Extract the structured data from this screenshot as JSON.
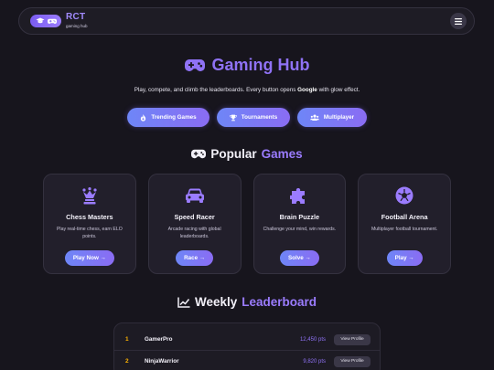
{
  "header": {
    "brand_name": "RCT",
    "brand_sub": "gaming hub",
    "logo_icons": [
      "graduation-cap-icon",
      "gamepad-icon"
    ],
    "menu_icon": "hamburger-icon"
  },
  "hero": {
    "title": "Gaming Hub",
    "subtitle_pre": "Play, compete, and climb the leaderboards. Every button opens ",
    "subtitle_bold": "Google",
    "subtitle_post": " with glow effect.",
    "buttons": [
      {
        "label": "Trending Games",
        "icon": "fire-icon"
      },
      {
        "label": "Tournaments",
        "icon": "trophy-icon"
      },
      {
        "label": "Multiplayer",
        "icon": "users-icon"
      }
    ]
  },
  "popular": {
    "title_word1": "Popular",
    "title_word2": "Games",
    "icon": "gamepad-icon"
  },
  "cards": [
    {
      "title": "Chess Masters",
      "desc": "Play real-time chess, earn ELO points.",
      "button": "Play Now →",
      "icon": "chess-icon"
    },
    {
      "title": "Speed Racer",
      "desc": "Arcade racing with global leaderboards.",
      "button": "Race →",
      "icon": "car-icon"
    },
    {
      "title": "Brain Puzzle",
      "desc": "Challenge your mind, win rewards.",
      "button": "Solve →",
      "icon": "puzzle-icon"
    },
    {
      "title": "Football Arena",
      "desc": "Multiplayer football tournament.",
      "button": "Play →",
      "icon": "football-icon"
    }
  ],
  "leaderboard": {
    "title_word1": "Weekly",
    "title_word2": "Leaderboard",
    "icon": "chart-line-icon",
    "rows": [
      {
        "rank": "1",
        "name": "GamerPro",
        "points": "12,450 pts",
        "button": "View Profile"
      },
      {
        "rank": "2",
        "name": "NinjaWarrior",
        "points": "9,820 pts",
        "button": "View Profile"
      }
    ]
  },
  "colors": {
    "accent": "#8f72f5",
    "background": "#17151d",
    "card": "#221f2b",
    "rank": "#ffb400"
  }
}
